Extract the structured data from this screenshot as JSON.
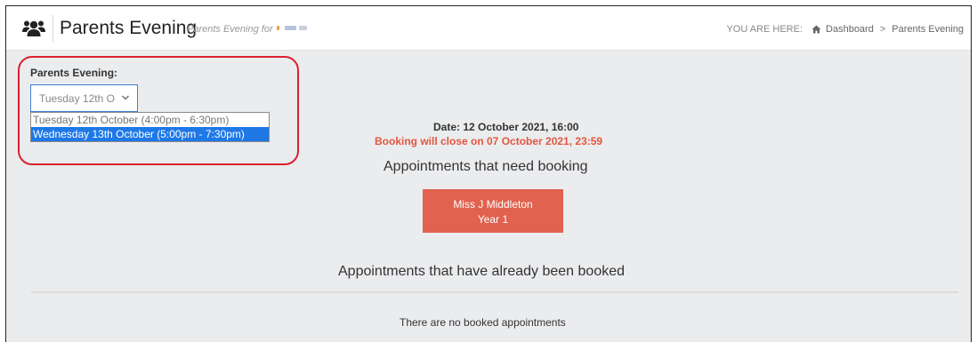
{
  "header": {
    "title": "Parents Evening",
    "subtitle": "Parents Evening for",
    "icon": "users-icon"
  },
  "breadcrumb": {
    "you_are_here": "YOU ARE HERE:",
    "home": "Dashboard",
    "current": "Parents Evening",
    "separator": ">"
  },
  "selector": {
    "label": "Parents Evening:",
    "current_value": "Tuesday 12th O",
    "options": [
      "Tuesday 12th October (4:00pm - 6:30pm)",
      "Wednesday 13th October (5:00pm - 7:30pm)"
    ],
    "highlighted_option": 1
  },
  "session": {
    "date": "Date: 12 October 2021, 16:00",
    "booking_close": "Booking will close on 07 October 2021, 23:59"
  },
  "need_booking": {
    "heading": "Appointments that need booking",
    "teacher_name": "Miss J Middleton",
    "teacher_class": "Year 1"
  },
  "booked": {
    "heading": "Appointments that have already been booked",
    "empty_text": "There are no booked appointments"
  },
  "colors": {
    "accent_blue": "#1e78e6",
    "teacher_button": "#e1624e",
    "warning_text": "#e2573f",
    "highlight_ring": "#d9212f",
    "page_background": "#ebecee"
  }
}
